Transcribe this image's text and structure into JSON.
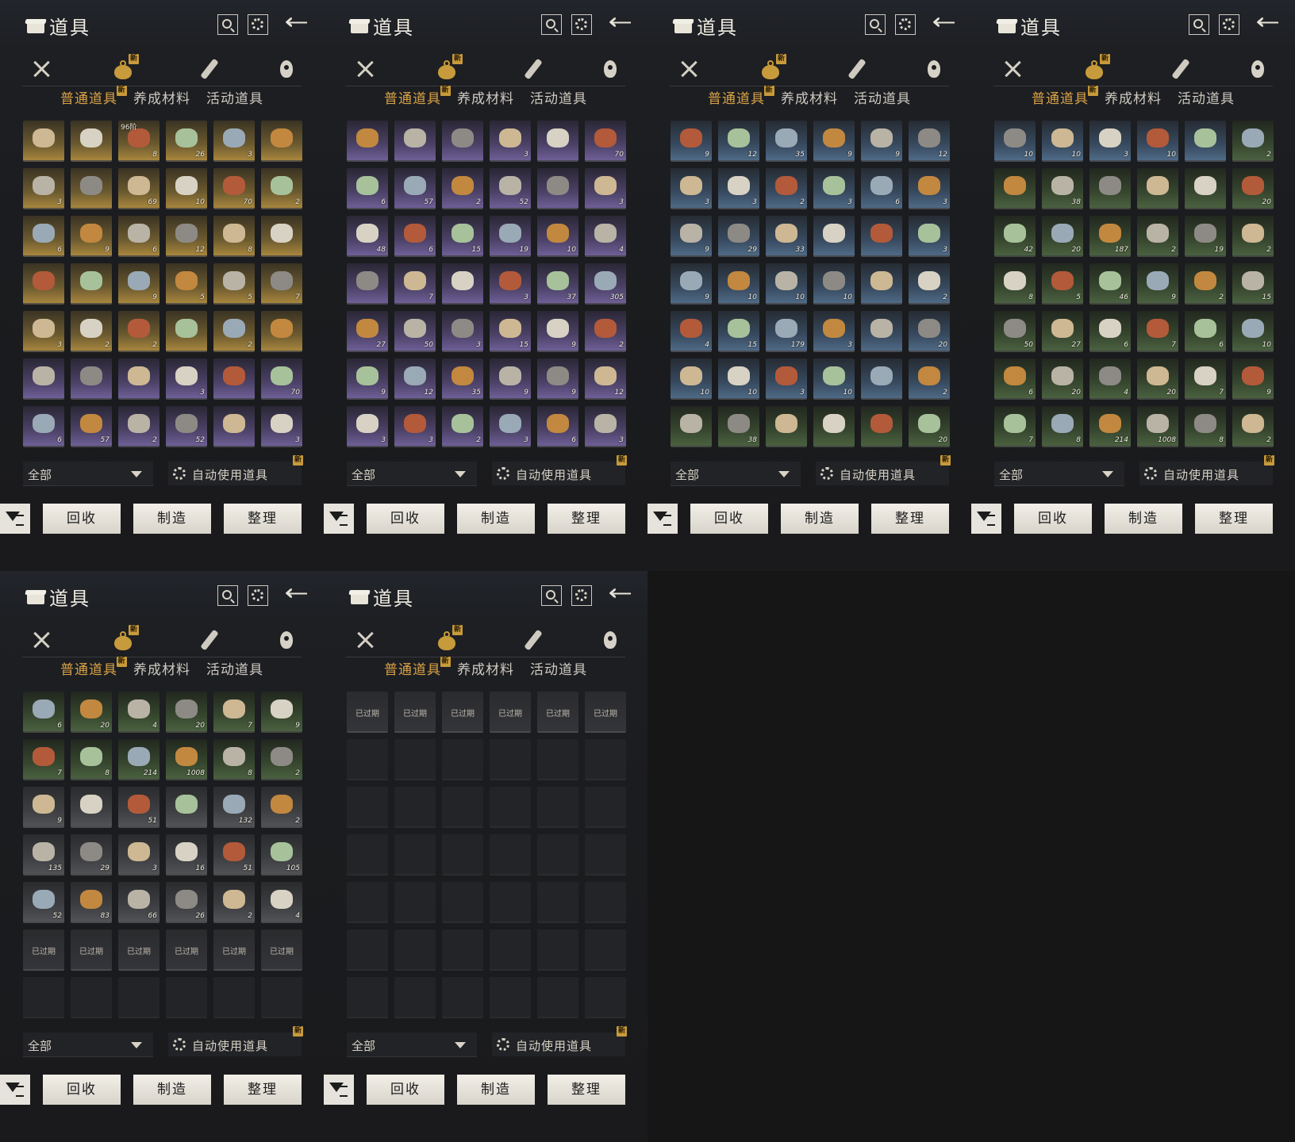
{
  "panel": {
    "title": "道具",
    "subtabs": [
      "普通道具",
      "养成材料",
      "活动道具"
    ],
    "new_badge": "新",
    "filter_label": "全部",
    "auto_use_label": "自动使用道具",
    "buttons": {
      "recycle": "回收",
      "craft": "制造",
      "sort": "整理"
    },
    "expired_label": "已过期"
  },
  "icons": [
    "box-icon",
    "search-icon",
    "gear-icon",
    "back-arrow-icon",
    "swords-icon",
    "bag-icon",
    "scroll-icon",
    "gem-icon",
    "filter-icon"
  ],
  "panels": [
    {
      "cells": [
        [
          "gold",
          ""
        ],
        [
          "gold",
          ""
        ],
        [
          "gold",
          "8"
        ],
        [
          "gold",
          "26"
        ],
        [
          "gold",
          "3"
        ],
        [
          "gold",
          ""
        ],
        [
          "gold",
          "3"
        ],
        [
          "gold",
          ""
        ],
        [
          "gold",
          "69"
        ],
        [
          "gold",
          "10"
        ],
        [
          "gold",
          "70"
        ],
        [
          "gold",
          "2"
        ],
        [
          "gold",
          "6"
        ],
        [
          "gold",
          "9"
        ],
        [
          "gold",
          "6"
        ],
        [
          "gold",
          "12"
        ],
        [
          "gold",
          "8"
        ],
        [
          "gold",
          ""
        ],
        [
          "gold",
          ""
        ],
        [
          "gold",
          ""
        ],
        [
          "gold",
          "9"
        ],
        [
          "gold",
          "5"
        ],
        [
          "gold",
          "5"
        ],
        [
          "gold",
          "7"
        ],
        [
          "gold",
          "3"
        ],
        [
          "gold",
          "2"
        ],
        [
          "gold",
          "2"
        ],
        [
          "gold",
          ""
        ],
        [
          "gold",
          "2"
        ],
        [
          "gold",
          ""
        ],
        [
          "purple",
          ""
        ],
        [
          "purple",
          ""
        ],
        [
          "purple",
          ""
        ],
        [
          "purple",
          "3"
        ],
        [
          "purple",
          ""
        ],
        [
          "purple",
          "70"
        ],
        [
          "purple",
          "6"
        ],
        [
          "purple",
          "57"
        ],
        [
          "purple",
          "2"
        ],
        [
          "purple",
          "52"
        ],
        [
          "purple",
          ""
        ],
        [
          "purple",
          "3"
        ]
      ],
      "tags": {
        "2": "96阶"
      }
    },
    {
      "cells": [
        [
          "purple",
          ""
        ],
        [
          "purple",
          ""
        ],
        [
          "purple",
          ""
        ],
        [
          "purple",
          "3"
        ],
        [
          "purple",
          ""
        ],
        [
          "purple",
          "70"
        ],
        [
          "purple",
          "6"
        ],
        [
          "purple",
          "57"
        ],
        [
          "purple",
          "2"
        ],
        [
          "purple",
          "52"
        ],
        [
          "purple",
          ""
        ],
        [
          "purple",
          "3"
        ],
        [
          "purple",
          "48"
        ],
        [
          "purple",
          "6"
        ],
        [
          "purple",
          "15"
        ],
        [
          "purple",
          "19"
        ],
        [
          "purple",
          "10"
        ],
        [
          "purple",
          "4"
        ],
        [
          "purple",
          ""
        ],
        [
          "purple",
          "7"
        ],
        [
          "purple",
          ""
        ],
        [
          "purple",
          "3"
        ],
        [
          "purple",
          "37"
        ],
        [
          "purple",
          "305"
        ],
        [
          "purple",
          "27"
        ],
        [
          "purple",
          "50"
        ],
        [
          "purple",
          "3"
        ],
        [
          "purple",
          "15"
        ],
        [
          "purple",
          "9"
        ],
        [
          "purple",
          "2"
        ],
        [
          "purple",
          "9"
        ],
        [
          "purple",
          "12"
        ],
        [
          "purple",
          "35"
        ],
        [
          "purple",
          "9"
        ],
        [
          "purple",
          "9"
        ],
        [
          "purple",
          "12"
        ],
        [
          "purple",
          "3"
        ],
        [
          "purple",
          "3"
        ],
        [
          "purple",
          "2"
        ],
        [
          "purple",
          "3"
        ],
        [
          "purple",
          "6"
        ],
        [
          "purple",
          "3"
        ]
      ],
      "tags": {}
    },
    {
      "cells": [
        [
          "blue",
          "9"
        ],
        [
          "blue",
          "12"
        ],
        [
          "blue",
          "35"
        ],
        [
          "blue",
          "9"
        ],
        [
          "blue",
          "9"
        ],
        [
          "blue",
          "12"
        ],
        [
          "blue",
          "3"
        ],
        [
          "blue",
          "3"
        ],
        [
          "blue",
          "2"
        ],
        [
          "blue",
          "3"
        ],
        [
          "blue",
          "6"
        ],
        [
          "blue",
          "3"
        ],
        [
          "blue",
          "9"
        ],
        [
          "blue",
          "29"
        ],
        [
          "blue",
          "33"
        ],
        [
          "blue",
          ""
        ],
        [
          "blue",
          ""
        ],
        [
          "blue",
          "3"
        ],
        [
          "blue",
          "9"
        ],
        [
          "blue",
          "10"
        ],
        [
          "blue",
          "10"
        ],
        [
          "blue",
          "10"
        ],
        [
          "blue",
          ""
        ],
        [
          "blue",
          "2"
        ],
        [
          "blue",
          "4"
        ],
        [
          "blue",
          "15"
        ],
        [
          "blue",
          "179"
        ],
        [
          "blue",
          "3"
        ],
        [
          "blue",
          ""
        ],
        [
          "blue",
          "20"
        ],
        [
          "blue",
          "10"
        ],
        [
          "blue",
          "10"
        ],
        [
          "blue",
          "3"
        ],
        [
          "blue",
          "10"
        ],
        [
          "blue",
          ""
        ],
        [
          "blue",
          "2"
        ],
        [
          "green",
          ""
        ],
        [
          "green",
          "38"
        ],
        [
          "green",
          ""
        ],
        [
          "green",
          ""
        ],
        [
          "green",
          ""
        ],
        [
          "green",
          "20"
        ]
      ],
      "tags": {}
    },
    {
      "cells": [
        [
          "blue",
          "10"
        ],
        [
          "blue",
          "10"
        ],
        [
          "blue",
          "3"
        ],
        [
          "blue",
          "10"
        ],
        [
          "blue",
          ""
        ],
        [
          "green",
          "2"
        ],
        [
          "green",
          ""
        ],
        [
          "green",
          "38"
        ],
        [
          "green",
          ""
        ],
        [
          "green",
          ""
        ],
        [
          "green",
          ""
        ],
        [
          "green",
          "20"
        ],
        [
          "green",
          "42"
        ],
        [
          "green",
          "20"
        ],
        [
          "green",
          "187"
        ],
        [
          "green",
          "2"
        ],
        [
          "green",
          "19"
        ],
        [
          "green",
          "2"
        ],
        [
          "green",
          "8"
        ],
        [
          "green",
          "5"
        ],
        [
          "green",
          "46"
        ],
        [
          "green",
          "9"
        ],
        [
          "green",
          "2"
        ],
        [
          "green",
          "15"
        ],
        [
          "green",
          "50"
        ],
        [
          "green",
          "27"
        ],
        [
          "green",
          "6"
        ],
        [
          "green",
          "7"
        ],
        [
          "green",
          "6"
        ],
        [
          "green",
          "10"
        ],
        [
          "green",
          "6"
        ],
        [
          "green",
          "20"
        ],
        [
          "green",
          "4"
        ],
        [
          "green",
          "20"
        ],
        [
          "green",
          "7"
        ],
        [
          "green",
          "9"
        ],
        [
          "green",
          "7"
        ],
        [
          "green",
          "8"
        ],
        [
          "green",
          "214"
        ],
        [
          "green",
          "1008"
        ],
        [
          "green",
          "8"
        ],
        [
          "green",
          "2"
        ]
      ],
      "tags": {}
    },
    {
      "cells": [
        [
          "green",
          "6"
        ],
        [
          "green",
          "20"
        ],
        [
          "green",
          "4"
        ],
        [
          "green",
          "20"
        ],
        [
          "green",
          "7"
        ],
        [
          "green",
          "9"
        ],
        [
          "green",
          "7"
        ],
        [
          "green",
          "8"
        ],
        [
          "green",
          "214"
        ],
        [
          "green",
          "1008"
        ],
        [
          "green",
          "8"
        ],
        [
          "green",
          "2"
        ],
        [
          "gray",
          "9"
        ],
        [
          "gray",
          ""
        ],
        [
          "gray",
          "51"
        ],
        [
          "gray",
          ""
        ],
        [
          "gray",
          "132"
        ],
        [
          "gray",
          "2"
        ],
        [
          "gray",
          "135"
        ],
        [
          "gray",
          "29"
        ],
        [
          "gray",
          "3"
        ],
        [
          "gray",
          "16"
        ],
        [
          "gray",
          "51"
        ],
        [
          "gray",
          "105"
        ],
        [
          "gray",
          "52"
        ],
        [
          "gray",
          "83"
        ],
        [
          "gray",
          "66"
        ],
        [
          "gray",
          "26"
        ],
        [
          "gray",
          "2"
        ],
        [
          "gray",
          "4"
        ],
        [
          "expired",
          ""
        ],
        [
          "expired",
          ""
        ],
        [
          "expired",
          ""
        ],
        [
          "expired",
          ""
        ],
        [
          "expired",
          ""
        ],
        [
          "expired",
          ""
        ],
        [
          "empty",
          ""
        ],
        [
          "empty",
          ""
        ],
        [
          "empty",
          ""
        ],
        [
          "empty",
          ""
        ],
        [
          "empty",
          ""
        ],
        [
          "empty",
          ""
        ]
      ],
      "tags": {}
    },
    {
      "cells": [
        [
          "expired",
          ""
        ],
        [
          "expired",
          ""
        ],
        [
          "expired",
          ""
        ],
        [
          "expired",
          ""
        ],
        [
          "expired",
          ""
        ],
        [
          "expired",
          ""
        ],
        [
          "empty",
          ""
        ],
        [
          "empty",
          ""
        ],
        [
          "empty",
          ""
        ],
        [
          "empty",
          ""
        ],
        [
          "empty",
          ""
        ],
        [
          "empty",
          ""
        ],
        [
          "empty",
          ""
        ],
        [
          "empty",
          ""
        ],
        [
          "empty",
          ""
        ],
        [
          "empty",
          ""
        ],
        [
          "empty",
          ""
        ],
        [
          "empty",
          ""
        ],
        [
          "empty",
          ""
        ],
        [
          "empty",
          ""
        ],
        [
          "empty",
          ""
        ],
        [
          "empty",
          ""
        ],
        [
          "empty",
          ""
        ],
        [
          "empty",
          ""
        ],
        [
          "empty",
          ""
        ],
        [
          "empty",
          ""
        ],
        [
          "empty",
          ""
        ],
        [
          "empty",
          ""
        ],
        [
          "empty",
          ""
        ],
        [
          "empty",
          ""
        ],
        [
          "empty",
          ""
        ],
        [
          "empty",
          ""
        ],
        [
          "empty",
          ""
        ],
        [
          "empty",
          ""
        ],
        [
          "empty",
          ""
        ],
        [
          "empty",
          ""
        ],
        [
          "empty",
          ""
        ],
        [
          "empty",
          ""
        ],
        [
          "empty",
          ""
        ],
        [
          "empty",
          ""
        ],
        [
          "empty",
          ""
        ],
        [
          "empty",
          ""
        ]
      ],
      "tags": {}
    }
  ]
}
